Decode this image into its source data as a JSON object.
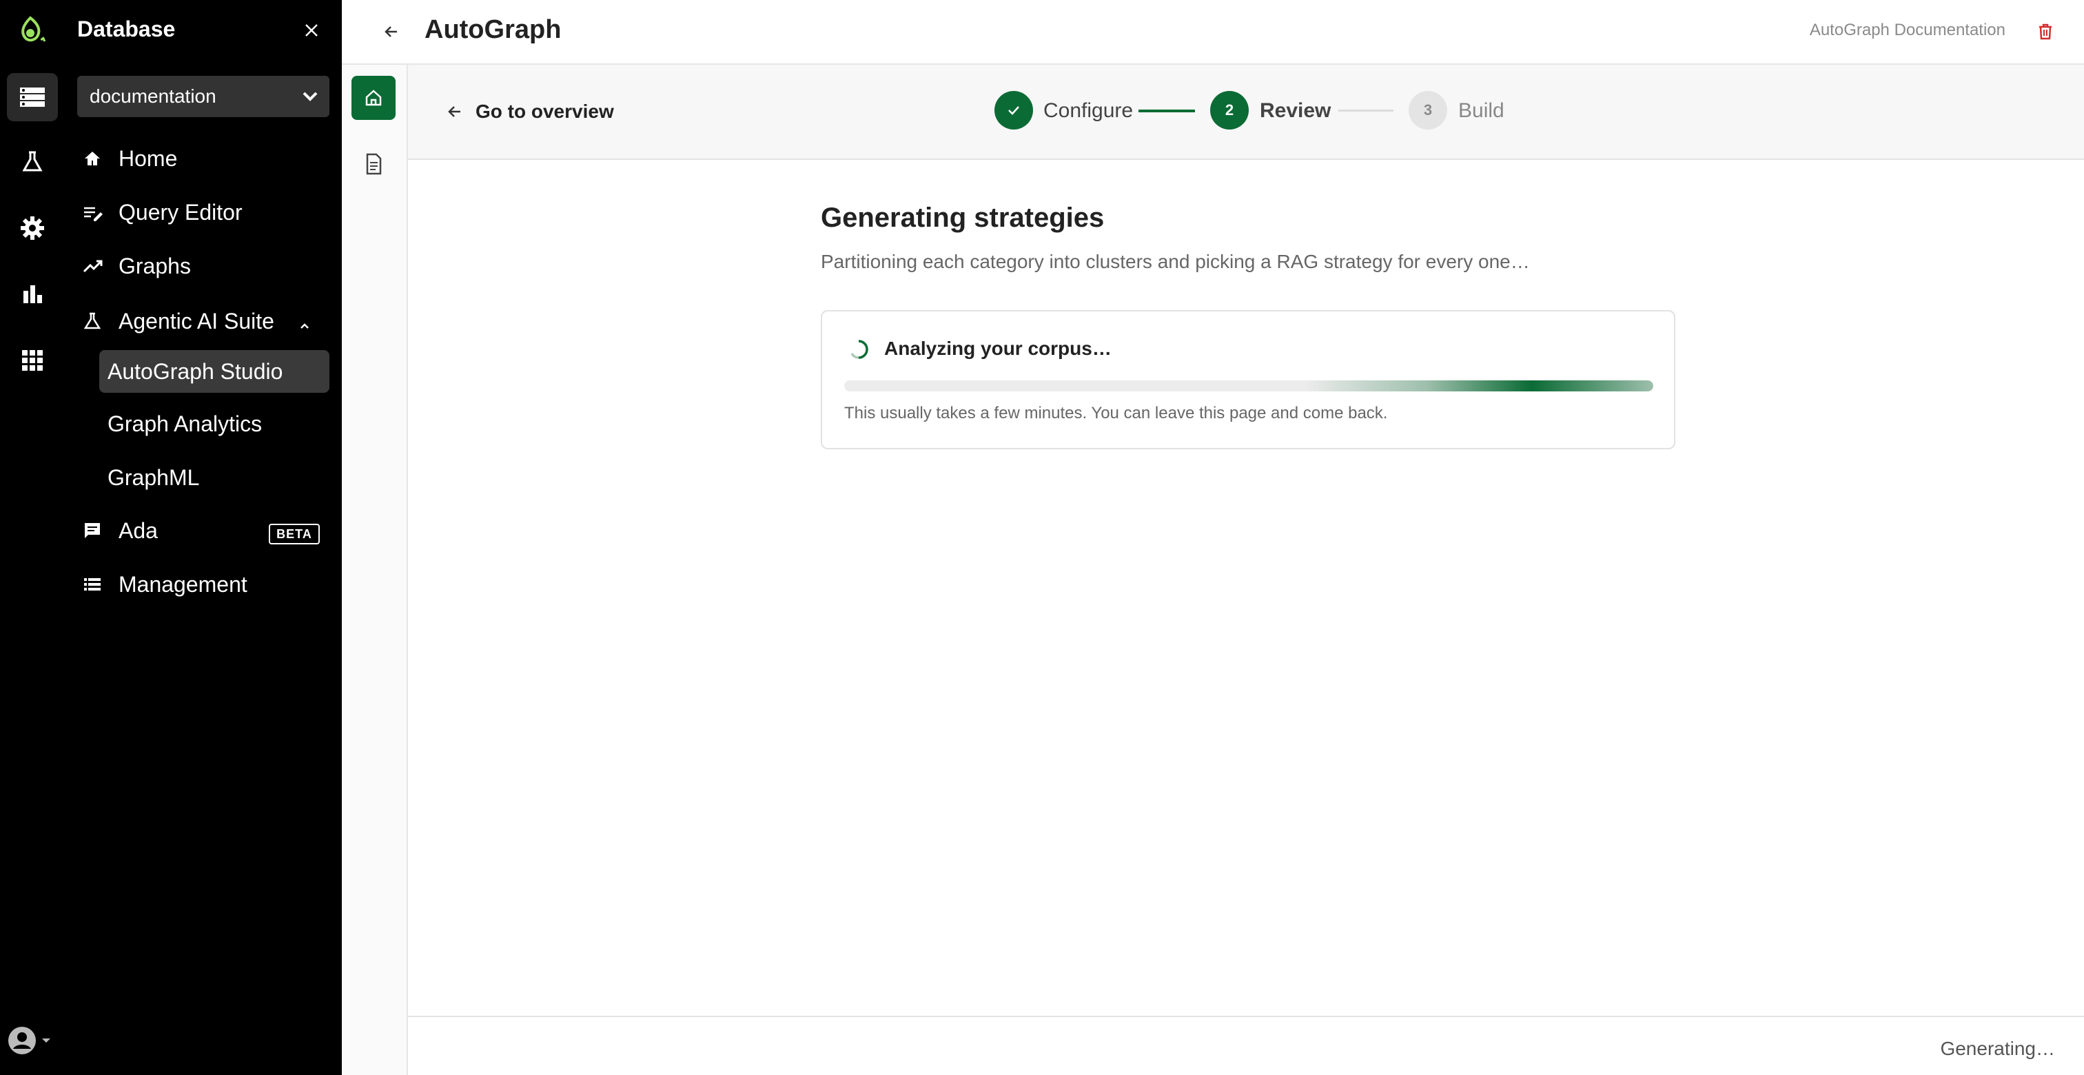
{
  "sidebar": {
    "title": "Database",
    "database_select": "documentation",
    "items": [
      {
        "label": "Home"
      },
      {
        "label": "Query Editor"
      },
      {
        "label": "Graphs"
      },
      {
        "label": "Agentic AI Suite"
      },
      {
        "label": "AutoGraph Studio"
      },
      {
        "label": "Graph Analytics"
      },
      {
        "label": "GraphML"
      },
      {
        "label": "Ada",
        "badge": "BETA"
      },
      {
        "label": "Management"
      }
    ]
  },
  "header": {
    "title": "AutoGraph",
    "doc_link": "AutoGraph Documentation"
  },
  "stepper": {
    "back_label": "Go to overview",
    "steps": [
      {
        "number": "",
        "label": "Configure",
        "state": "complete"
      },
      {
        "number": "2",
        "label": "Review",
        "state": "active"
      },
      {
        "number": "3",
        "label": "Build",
        "state": "pending"
      }
    ]
  },
  "main": {
    "title": "Generating strategies",
    "subtitle": "Partitioning each category into clusters and picking a RAG strategy for every one…",
    "progress_card": {
      "title": "Analyzing your corpus…",
      "hint": "This usually takes a few minutes. You can leave this page and come back."
    }
  },
  "footer": {
    "status": "Generating…"
  },
  "colors": {
    "accent": "#0b6b35",
    "danger": "#d32f2f",
    "sidebar_bg": "#000000"
  }
}
